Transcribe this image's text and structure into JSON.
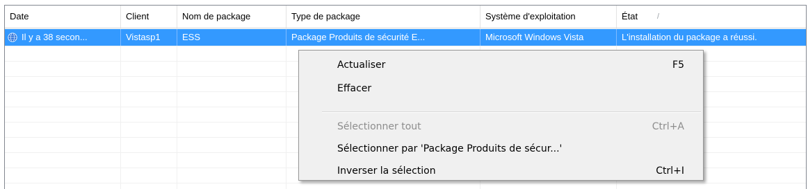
{
  "columns": [
    {
      "label": "Date"
    },
    {
      "label": "Client"
    },
    {
      "label": "Nom de package"
    },
    {
      "label": "Type de package"
    },
    {
      "label": "Système d'exploitation"
    },
    {
      "label": "État"
    }
  ],
  "sort_indicator": "/",
  "rows": [
    {
      "selected": true,
      "icon": "globe-status-icon",
      "date": "Il y a 38 secon...",
      "client": "Vistasp1",
      "package_name": "ESS",
      "package_type": "Package Produits de sécurité E...",
      "os": "Microsoft Windows Vista",
      "state": "L'installation du package a réussi."
    }
  ],
  "context_menu": {
    "refresh": {
      "label": "Actualiser",
      "shortcut": "F5"
    },
    "clear": {
      "label": "Effacer"
    },
    "select_all": {
      "label": "Sélectionner tout",
      "shortcut": "Ctrl+A",
      "disabled": true
    },
    "select_by": {
      "label": "Sélectionner par 'Package Produits de sécur...'"
    },
    "invert": {
      "label": "Inverser la sélection",
      "shortcut": "Ctrl+I"
    }
  },
  "colors": {
    "selection": "#3399ff",
    "menu_bg": "#f0f0f0",
    "disabled_text": "#8d8d8d"
  }
}
